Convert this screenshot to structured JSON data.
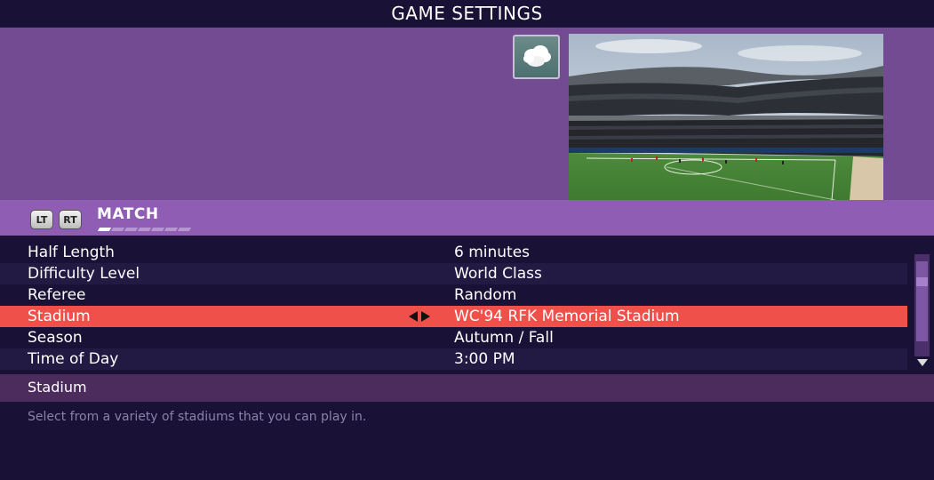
{
  "header": {
    "title": "GAME SETTINGS"
  },
  "preview": {
    "weather_icon": "cloud-icon"
  },
  "category": {
    "left_trigger": "LT",
    "right_trigger": "RT",
    "label": "MATCH",
    "current_page": 1,
    "total_pages": 7
  },
  "settings": [
    {
      "label": "Half Length",
      "value": "6 minutes"
    },
    {
      "label": "Difficulty Level",
      "value": "World Class"
    },
    {
      "label": "Referee",
      "value": "Random"
    },
    {
      "label": "Stadium",
      "value": "WC'94 RFK Memorial Stadium",
      "selected": true
    },
    {
      "label": "Season",
      "value": "Autumn / Fall"
    },
    {
      "label": "Time of Day",
      "value": "3:00 PM"
    }
  ],
  "help": {
    "title": "Stadium",
    "text": "Select from a variety of stadiums that you can play in."
  },
  "colors": {
    "background": "#1a1236",
    "preview_band": "#724b92",
    "category_bar": "#8f5db4",
    "selected_row": "#f0504a",
    "help_header": "#4b2c5c"
  }
}
